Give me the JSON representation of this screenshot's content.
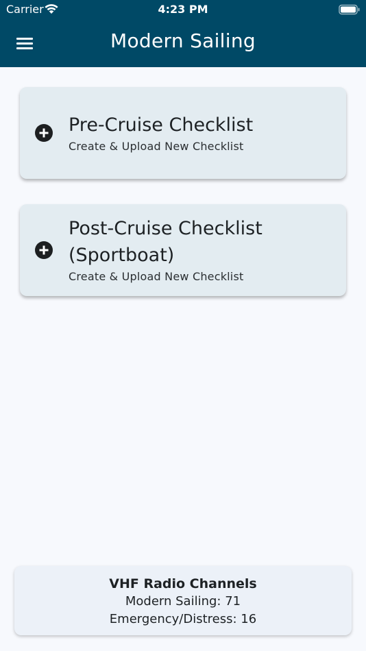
{
  "status_bar": {
    "carrier": "Carrier",
    "time": "4:23 PM",
    "wifi_icon": "wifi-icon",
    "battery_icon": "battery-icon"
  },
  "app_bar": {
    "title": "Modern Sailing",
    "menu_icon": "hamburger-menu-icon",
    "background_color": "#004966"
  },
  "checklists": [
    {
      "title": "Pre-Cruise Checklist",
      "subtitle": "Create & Upload New Checklist",
      "icon": "plus-circle-icon"
    },
    {
      "title": "Post-Cruise Checklist (Sportboat)",
      "subtitle": "Create & Upload New Checklist",
      "icon": "plus-circle-icon"
    }
  ],
  "vhf": {
    "title": "VHF Radio Channels",
    "lines": [
      "Modern Sailing: 71",
      "Emergency/Distress: 16"
    ]
  },
  "colors": {
    "header": "#004966",
    "card": "#e3ecf1",
    "background": "#f7f9fd"
  }
}
